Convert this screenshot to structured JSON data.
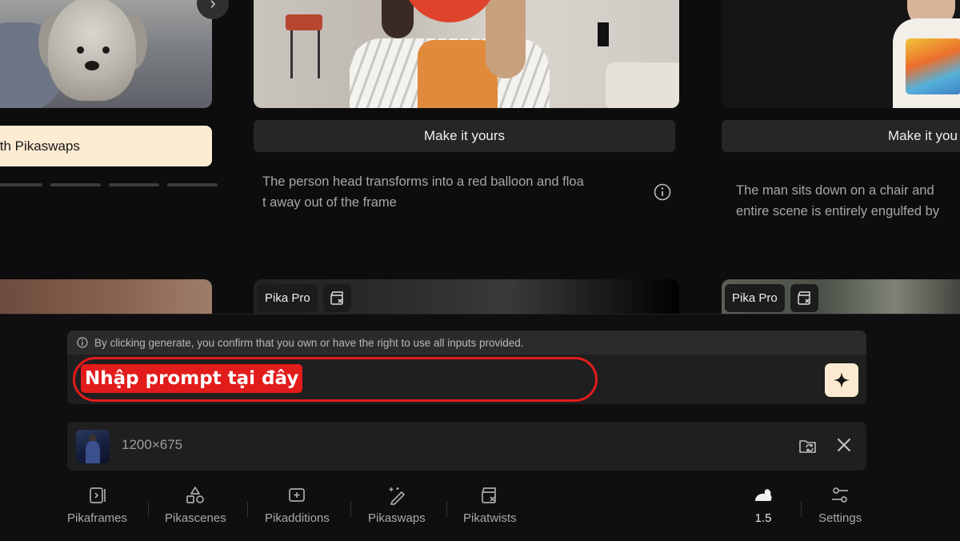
{
  "gallery": {
    "left_card": {
      "button_label": "ith Pikaswaps",
      "next_arrow": "›"
    },
    "center_card": {
      "button_label": "Make it yours",
      "description_line1": "The person head transforms into a red balloon and floa",
      "description_line2": "t away out of the frame"
    },
    "right_card": {
      "button_label": "Make it you",
      "description_line1": "The man sits down on a chair and",
      "description_line2": "entire scene is entirely engulfed by"
    },
    "next_row_tags": {
      "center_tag": "Pika Pro",
      "right_tag": "Pika Pro"
    }
  },
  "composer": {
    "notice": "By clicking generate, you confirm that you own or have the right to use all inputs provided.",
    "prompt_annotation": "Nhập prompt tại đây",
    "media_size": "1200×675"
  },
  "toolbar": {
    "items": [
      {
        "label": "Pikaframes",
        "icon": "pikaframes-icon"
      },
      {
        "label": "Pikascenes",
        "icon": "pikascenes-icon"
      },
      {
        "label": "Pikadditions",
        "icon": "pikadditions-icon"
      },
      {
        "label": "Pikaswaps",
        "icon": "pikaswaps-icon"
      },
      {
        "label": "Pikatwists",
        "icon": "pikatwists-icon"
      }
    ],
    "model_version": "1.5",
    "settings_label": "Settings"
  },
  "colors": {
    "background": "#0d0d0d",
    "card": "#1f1f1f",
    "accent_cream": "#fdebd2",
    "highlight_red": "#e21b1b"
  }
}
